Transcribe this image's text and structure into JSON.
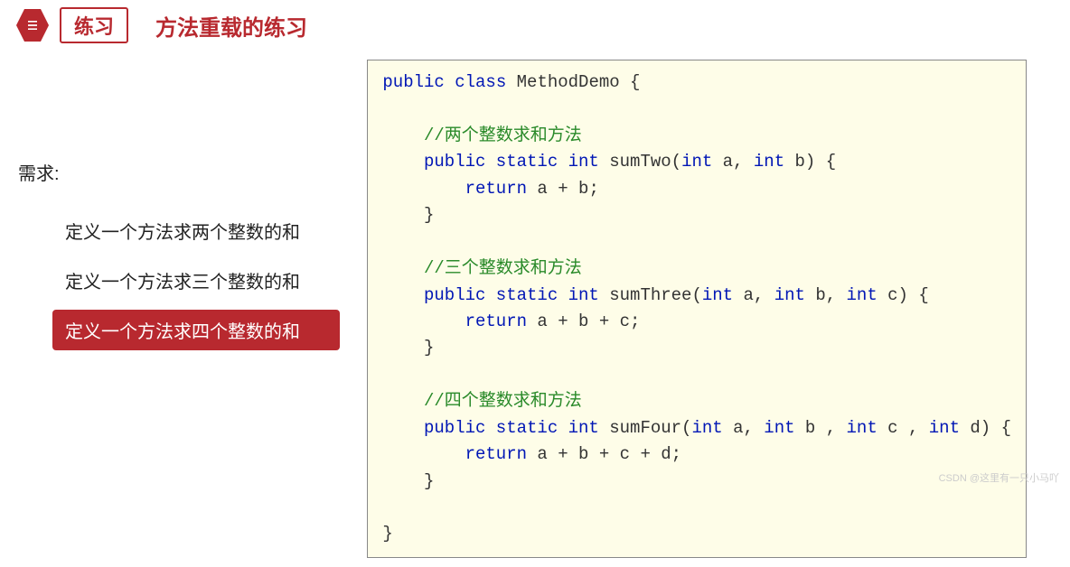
{
  "header": {
    "badge": "练习",
    "title": "方法重载的练习"
  },
  "left": {
    "label": "需求:",
    "items": [
      {
        "text": "定义一个方法求两个整数的和",
        "highlight": false
      },
      {
        "text": "定义一个方法求三个整数的和",
        "highlight": false
      },
      {
        "text": "定义一个方法求四个整数的和",
        "highlight": true
      }
    ]
  },
  "code": {
    "line1_a": "public",
    "line1_b": " class",
    "line1_c": " MethodDemo {",
    "c1": "    //两个整数求和方法",
    "m1a": "    public static int",
    "m1b": " sumTwo(",
    "m1c": "int",
    "m1d": " a, ",
    "m1e": "int",
    "m1f": " b) {",
    "m1r": "        return",
    "m1r2": " a + b;",
    "m1end": "    }",
    "c2": "    //三个整数求和方法",
    "m2a": "    public static int",
    "m2b": " sumThree(",
    "m2c": "int",
    "m2d": " a, ",
    "m2e": "int",
    "m2f": " b, ",
    "m2g": "int",
    "m2h": " c) {",
    "m2r": "        return",
    "m2r2": " a + b + c;",
    "m2end": "    }",
    "c3": "    //四个整数求和方法",
    "m3a": "    public static int",
    "m3b": " sumFour(",
    "m3c": "int",
    "m3d": " a, ",
    "m3e": "int",
    "m3f": " b , ",
    "m3g": "int",
    "m3h": " c , ",
    "m3i": "int",
    "m3j": " d) {",
    "m3r": "        return",
    "m3r2": " a + b + c + d;",
    "m3end": "    }",
    "close": "}"
  },
  "watermark": "CSDN @这里有一只小马吖"
}
